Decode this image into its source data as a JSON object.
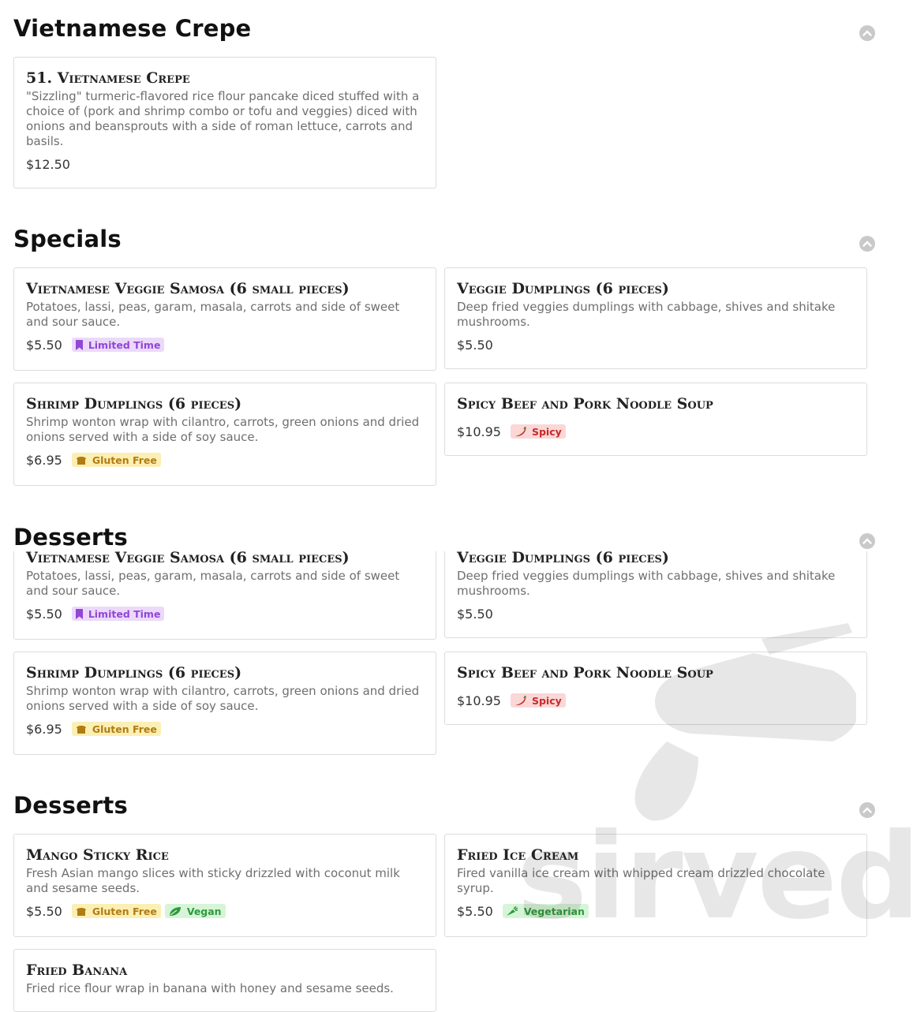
{
  "sections": [
    {
      "title": "Vietnamese Crepe",
      "items": [
        {
          "name": "51. Vietnamese Crepe",
          "desc": "\"Sizzling\" turmeric-flavored rice flour pancake diced stuffed with a choice of (pork and shrimp combo or tofu and veggies) diced with onions and beansprouts with a side of roman lettuce, carrots and basils.",
          "price": "$12.50"
        }
      ]
    },
    {
      "title": "Specials",
      "items": [
        {
          "name": "Vietnamese Veggie Samosa (6 small pieces)",
          "desc": "Potatoes, lassi, peas, garam, masala, carrots and side of sweet and sour sauce.",
          "price": "$5.50",
          "badge": "Limited Time"
        },
        {
          "name": "Veggie Dumplings (6 pieces)",
          "desc": "Deep fried veggies dumplings with cabbage, shives and shitake mushrooms.",
          "price": "$5.50"
        },
        {
          "name": "Shrimp Dumplings (6 pieces)",
          "desc": "Shrimp wonton wrap with cilantro, carrots, green onions and dried onions served with a side of soy sauce.",
          "price": "$6.95",
          "badge": "Gluten Free"
        },
        {
          "name": "Spicy Beef and Pork Noodle Soup",
          "price": "$10.95",
          "badge": "Spicy"
        }
      ]
    },
    {
      "title": "Desserts",
      "items": [
        {
          "name": "Vietnamese Veggie Samosa (6 small pieces)",
          "desc": "Potatoes, lassi, peas, garam, masala, carrots and side of sweet and sour sauce.",
          "price": "$5.50",
          "badge": "Limited Time"
        },
        {
          "name": "Veggie Dumplings (6 pieces)",
          "desc": "Deep fried veggies dumplings with cabbage, shives and shitake mushrooms.",
          "price": "$5.50"
        },
        {
          "name": "Shrimp Dumplings (6 pieces)",
          "desc": "Shrimp wonton wrap with cilantro, carrots, green onions and dried onions served with a side of soy sauce.",
          "price": "$6.95",
          "badge": "Gluten Free"
        },
        {
          "name": "Spicy Beef and Pork Noodle Soup",
          "price": "$10.95",
          "badge": "Spicy"
        }
      ]
    },
    {
      "title": "Desserts",
      "items": [
        {
          "name": "Mango Sticky Rice",
          "desc": "Fresh Asian mango slices with sticky drizzled with coconut milk and sesame seeds.",
          "price": "$5.50",
          "badges": [
            "Gluten Free",
            "Vegan"
          ]
        },
        {
          "name": "Fried Ice Cream",
          "desc": "Fired vanilla ice cream with whipped cream drizzled chocolate syrup.",
          "price": "$5.50",
          "badge": "Vegetarian"
        },
        {
          "name": "Fried Banana",
          "desc": "Fried rice flour wrap in banana with honey and sesame seeds."
        }
      ]
    }
  ],
  "watermark": "sirved",
  "colors": {
    "limited": "#9146d6",
    "gluten_free": "#b17c12",
    "vegan": "#2f9a3b",
    "spicy": "#c62a2a",
    "collapse": "#c9c9c9"
  }
}
